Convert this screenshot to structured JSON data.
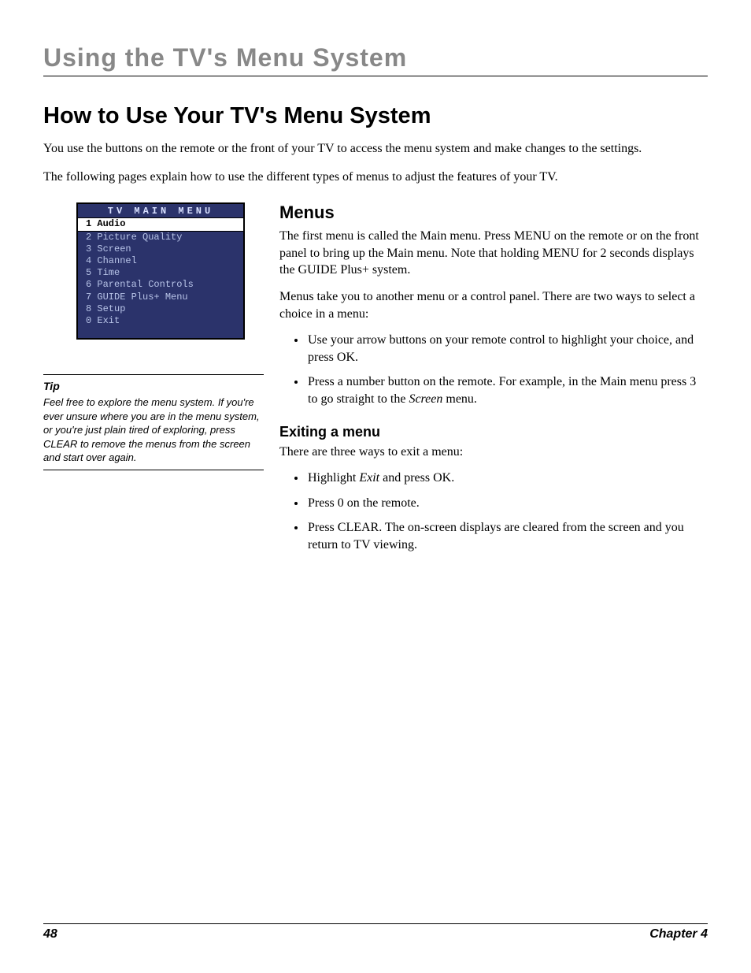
{
  "chapter_head": "Using the TV's Menu System",
  "h1": "How to Use Your TV's Menu System",
  "intro": {
    "p1": "You use the buttons on the remote or the front of your TV to access the menu system and make changes to the settings.",
    "p2": "The following pages explain how to use the different types of menus to adjust the features of your TV."
  },
  "tv_menu": {
    "title": "TV MAIN MENU",
    "items": [
      {
        "num": "1",
        "label": "Audio",
        "selected": true
      },
      {
        "num": "2",
        "label": "Picture Quality",
        "selected": false
      },
      {
        "num": "3",
        "label": "Screen",
        "selected": false
      },
      {
        "num": "4",
        "label": "Channel",
        "selected": false
      },
      {
        "num": "5",
        "label": "Time",
        "selected": false
      },
      {
        "num": "6",
        "label": "Parental Controls",
        "selected": false
      },
      {
        "num": "7",
        "label": "GUIDE Plus+ Menu",
        "selected": false
      },
      {
        "num": "8",
        "label": "Setup",
        "selected": false
      },
      {
        "num": "0",
        "label": "Exit",
        "selected": false
      }
    ]
  },
  "tip": {
    "heading": "Tip",
    "body": "Feel free to explore the menu system. If you're ever unsure where you are in the menu system, or you're just plain tired of exploring, press CLEAR to remove the menus from the screen and start over again."
  },
  "menus": {
    "heading": "Menus",
    "p1": "The first menu is called the Main menu. Press MENU on the remote or on the front panel to bring up the Main menu. Note that holding MENU for 2 seconds displays the GUIDE Plus+ system.",
    "p2": "Menus take you to another menu or a control panel. There are two ways to select a choice in a menu:",
    "li1": "Use your arrow buttons on your remote control to highlight your choice, and press OK.",
    "li2_a": "Press a number button on the remote. For example, in the Main menu press 3 to go straight to the ",
    "li2_italic": "Screen",
    "li2_b": " menu."
  },
  "exiting": {
    "heading": "Exiting a menu",
    "p1": "There are three ways to exit a menu:",
    "li1_a": "Highlight ",
    "li1_italic": "Exit",
    "li1_b": " and press OK.",
    "li2": "Press 0 on the remote.",
    "li3": "Press CLEAR. The on-screen displays are cleared from the screen and you return to TV viewing."
  },
  "footer": {
    "page": "48",
    "chapter": "Chapter 4"
  }
}
